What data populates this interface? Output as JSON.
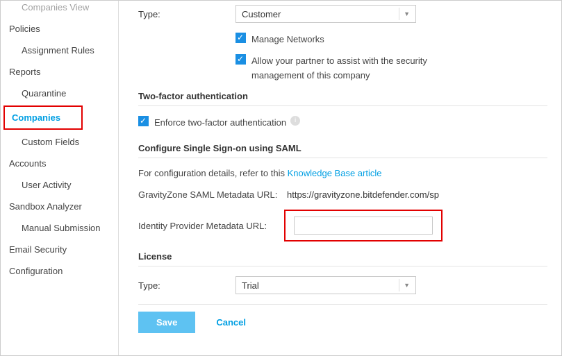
{
  "sidebar": {
    "items": [
      {
        "label": "Companies View",
        "child": true,
        "cut": true
      },
      {
        "label": "Policies"
      },
      {
        "label": "Assignment Rules",
        "child": true
      },
      {
        "label": "Reports"
      },
      {
        "label": "Quarantine",
        "child": true
      },
      {
        "label": "Companies",
        "active": true,
        "highlighted": true
      },
      {
        "label": "Custom Fields",
        "child": true
      },
      {
        "label": "Accounts"
      },
      {
        "label": "User Activity",
        "child": true
      },
      {
        "label": "Sandbox Analyzer"
      },
      {
        "label": "Manual Submission",
        "child": true
      },
      {
        "label": "Email Security"
      },
      {
        "label": "Configuration"
      }
    ]
  },
  "form": {
    "type_label": "Type:",
    "type_value": "Customer",
    "manage_networks_label": "Manage Networks",
    "allow_partner_label": "Allow your partner to assist with the security management of this company",
    "twofa_section": "Two-factor authentication",
    "enforce_2fa_label": "Enforce two-factor authentication",
    "sso_section": "Configure Single Sign-on using SAML",
    "sso_help_prefix": "For configuration details, refer to this ",
    "sso_help_link": "Knowledge Base article",
    "saml_url_label": "GravityZone SAML Metadata URL:",
    "saml_url_value": "https://gravityzone.bitdefender.com/sp",
    "idp_url_label": "Identity Provider Metadata URL:",
    "idp_url_value": "",
    "license_section": "License",
    "license_type_label": "Type:",
    "license_type_value": "Trial"
  },
  "footer": {
    "save": "Save",
    "cancel": "Cancel"
  }
}
